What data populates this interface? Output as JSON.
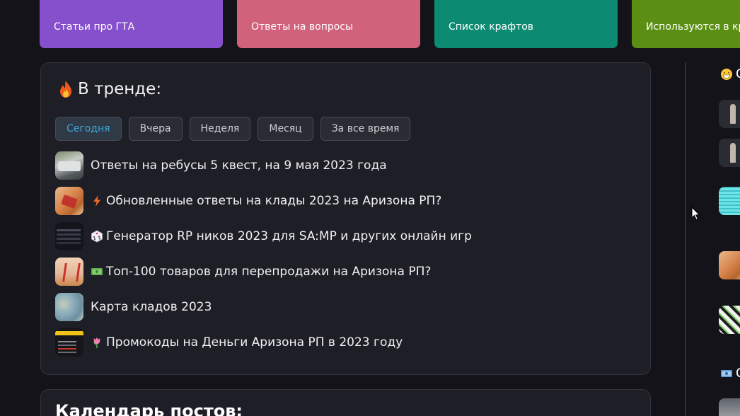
{
  "categories": [
    {
      "label": "Статьи про ГТА",
      "color": "#8650cc"
    },
    {
      "label": "Ответы на вопросы",
      "color": "#d0627c"
    },
    {
      "label": "Список крафтов",
      "color": "#0d8b72"
    },
    {
      "label": "Используются в кр",
      "color": "#5b8f14"
    }
  ],
  "trending": {
    "title": "В тренде:",
    "title_icon": "flame-icon",
    "tabs": [
      {
        "label": "Сегодня",
        "active": true
      },
      {
        "label": "Вчера",
        "active": false
      },
      {
        "label": "Неделя",
        "active": false
      },
      {
        "label": "Месяц",
        "active": false
      },
      {
        "label": "За все время",
        "active": false
      }
    ],
    "items": [
      {
        "emoji": "",
        "text": "Ответы на ребусы 5 квест, на 9 мая 2023 года"
      },
      {
        "emoji": "lightning-icon",
        "text": "Обновленные ответы на клады 2023 на Аризона РП?"
      },
      {
        "emoji": "dice-icon",
        "text": "Генератор RP ников 2023 для SA:MP и других онлайн игр"
      },
      {
        "emoji": "money-icon",
        "text": "Топ-100 товаров для перепродажи на Аризона РП?"
      },
      {
        "emoji": "",
        "text": "Карта кладов 2023"
      },
      {
        "emoji": "tulip-icon",
        "text": "Промокоды на Деньги Аризона РП в 2023 году"
      }
    ]
  },
  "sidebar": {
    "heading1": "С",
    "heading1_icon": "grin-icon",
    "heading2": "С",
    "heading2_icon": "money-icon"
  },
  "calendar": {
    "title": "Календарь постов:"
  }
}
